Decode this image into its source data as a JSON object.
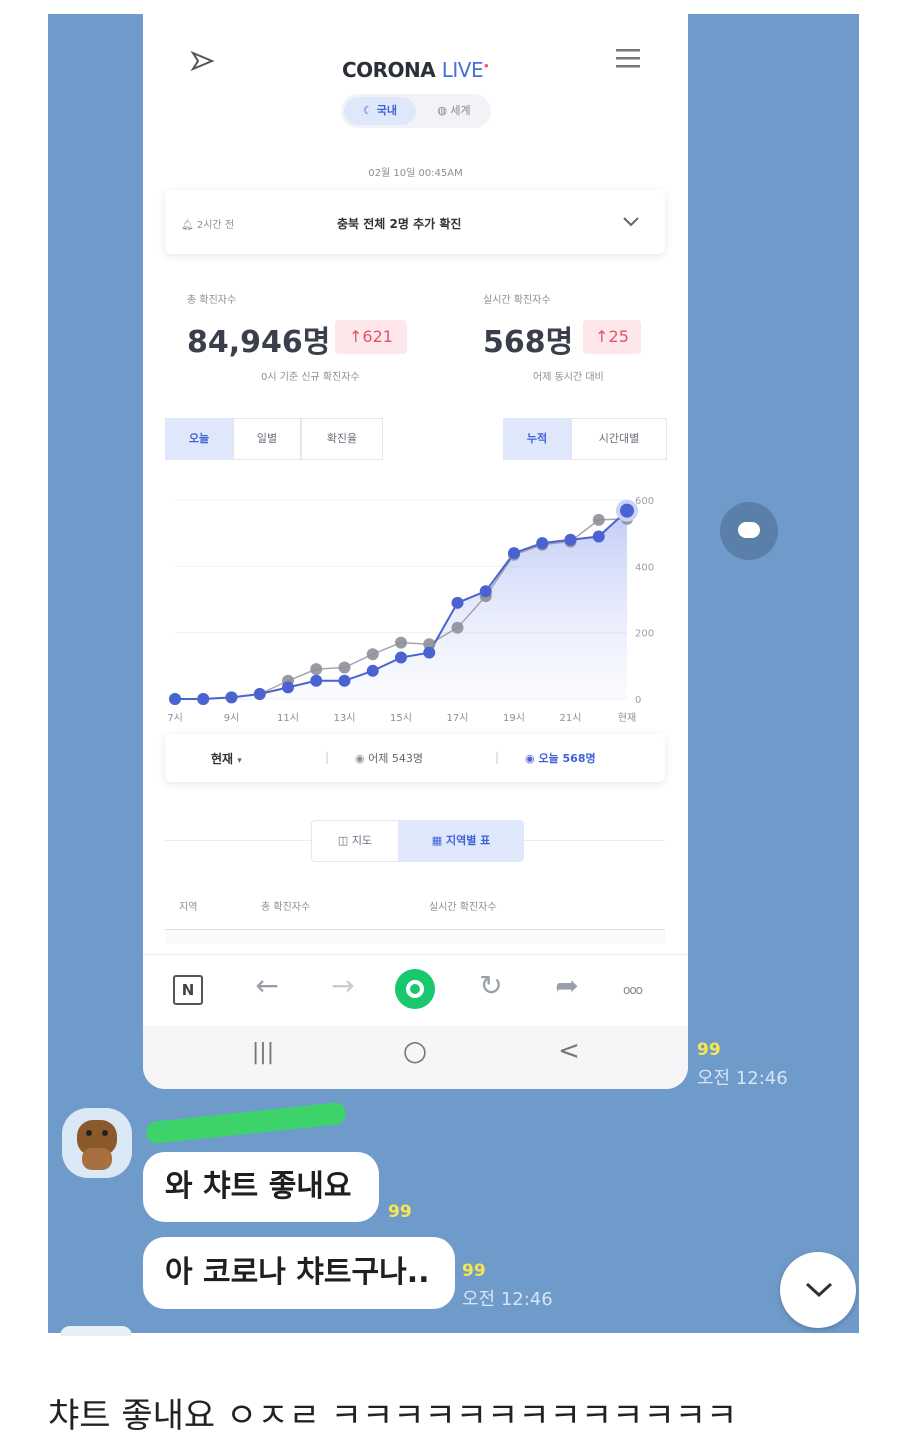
{
  "app": {
    "brand_main": "CORONA",
    "brand_accent": "LIVE",
    "tabs": [
      "국내",
      "세계"
    ],
    "timestamp": "02월 10일 00:45AM",
    "notice": {
      "ago": "2시간 전",
      "text": "충북 전체 2명 추가 확진"
    },
    "stats": [
      {
        "label": "총 확진자수",
        "value": "84,946명",
        "delta": "↑621",
        "note": "0시 기준 신규 확진자수"
      },
      {
        "label": "실시간 확진자수",
        "value": "568명",
        "delta": "↑25",
        "note": "어제 동시간 대비"
      }
    ],
    "range_tabs": [
      "오늘",
      "일별",
      "확진율"
    ],
    "mode_tabs": [
      "누적",
      "시간대별"
    ],
    "legend": {
      "select": "현재",
      "yesterday": "어제 543명",
      "today": "오늘 568명"
    },
    "view_tabs": [
      "지도",
      "지역별 표"
    ],
    "table_headers": [
      "지역",
      "총 확진자수",
      "실시간 확진자수"
    ]
  },
  "chart_data": {
    "type": "line",
    "x": [
      "7시",
      "8시",
      "9시",
      "10시",
      "11시",
      "12시",
      "13시",
      "14시",
      "15시",
      "16시",
      "17시",
      "18시",
      "19시",
      "20시",
      "21시",
      "22시",
      "현재"
    ],
    "x_tick_labels": [
      "7시",
      "9시",
      "11시",
      "13시",
      "15시",
      "17시",
      "19시",
      "21시",
      "현재"
    ],
    "series": [
      {
        "name": "오늘",
        "color": "#4a63d0",
        "values": [
          0,
          0,
          5,
          15,
          35,
          55,
          55,
          85,
          125,
          140,
          290,
          325,
          440,
          470,
          480,
          490,
          568
        ]
      },
      {
        "name": "어제",
        "color": "#8e9098",
        "values": [
          0,
          0,
          5,
          15,
          55,
          90,
          95,
          135,
          170,
          165,
          215,
          310,
          435,
          465,
          475,
          540,
          543
        ]
      }
    ],
    "y_ticks": [
      "600",
      "400",
      "200",
      "0"
    ],
    "ylim": [
      0,
      600
    ],
    "grid": true
  },
  "browser": {
    "icons": [
      "naver-icon",
      "back-icon",
      "forward-icon",
      "home-icon",
      "refresh-icon",
      "share-icon",
      "more-icon"
    ]
  },
  "android_nav": {
    "recent": "|||",
    "home": "○",
    "back": "<"
  },
  "chat": {
    "read1": "99",
    "time1": "오전 12:46",
    "msg1": "와 챠트 좋내요",
    "read2": "99",
    "msg2": "아 코로나 챠트구나..",
    "read3": "99",
    "time3": "오전 12:46"
  },
  "caption": "챠트 좋내요 ㅇㅈㄹ ㅋㅋㅋㅋㅋㅋㅋㅋㅋㅋㅋㅋㅋ"
}
